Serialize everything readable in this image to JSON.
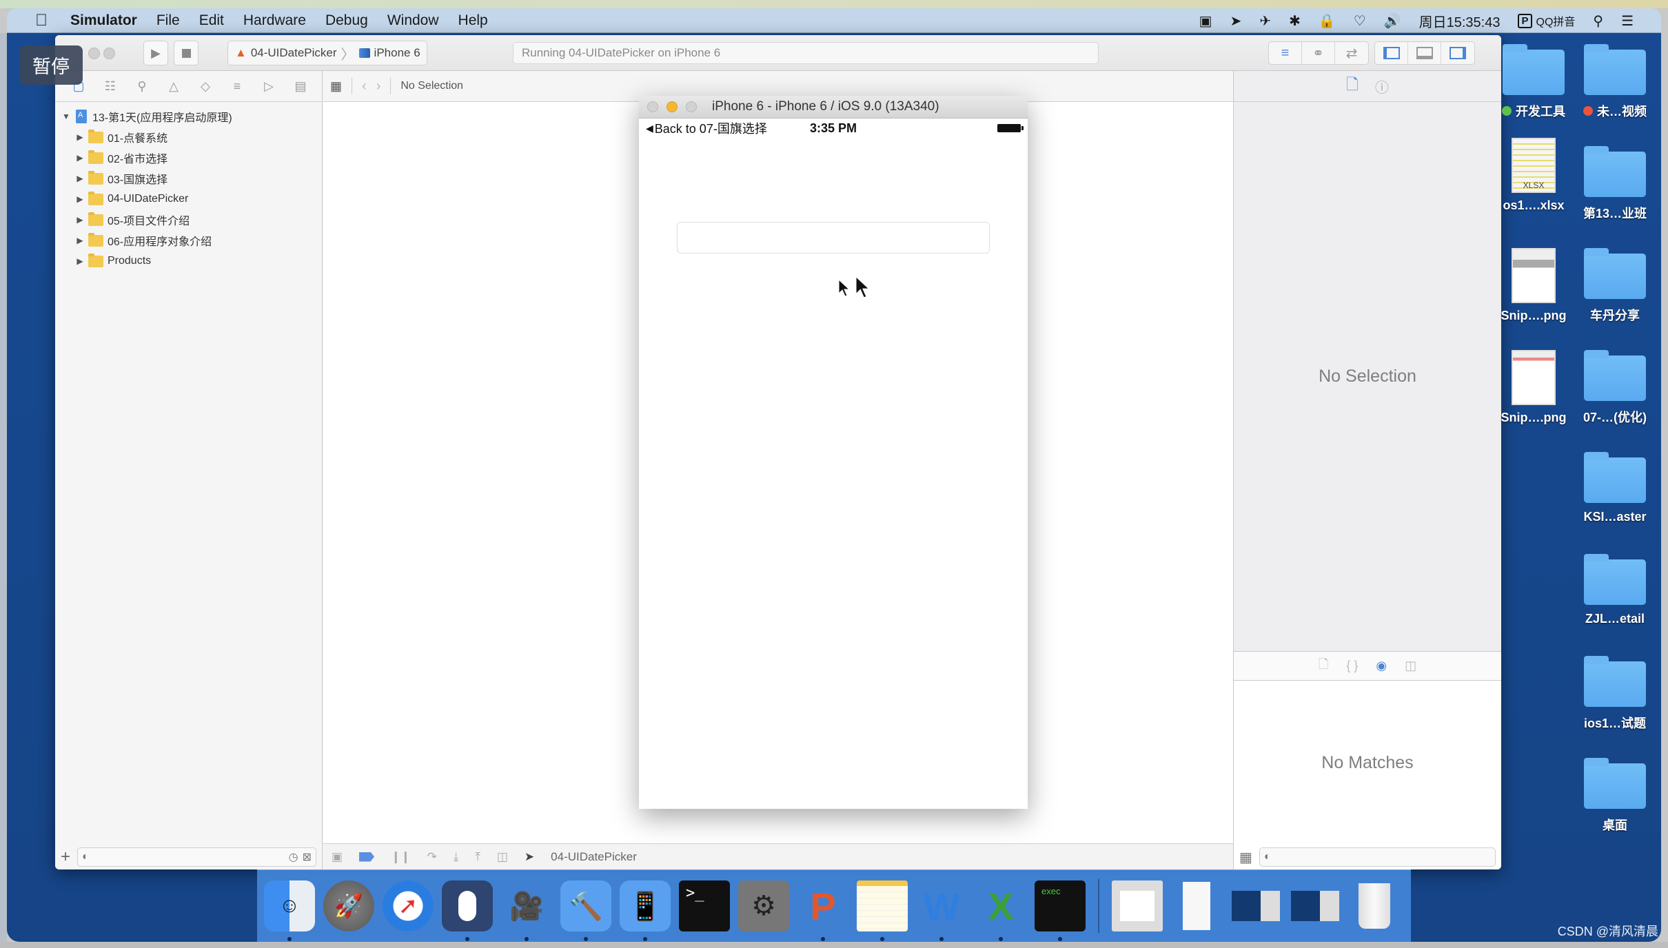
{
  "menubar": {
    "apple_icon": "apple-logo",
    "app_name": "Simulator",
    "items": [
      "File",
      "Edit",
      "Hardware",
      "Debug",
      "Window",
      "Help"
    ],
    "status_icons": [
      "screen-record-icon",
      "location-icon",
      "airplane-icon",
      "bluetooth-icon",
      "lock-icon",
      "wifi-icon",
      "volume-icon"
    ],
    "clock": "周日15:35:43",
    "ime_badge": "P",
    "ime_label": "QQ拼音",
    "spotlight_icon": "search-icon",
    "notification_icon": "list-icon"
  },
  "overlay": {
    "pause_label": "暂停"
  },
  "xcode": {
    "toolbar": {
      "run_icon": "play-icon",
      "stop_icon": "stop-icon",
      "scheme_name": "04-UIDatePicker",
      "scheme_separator": "〉",
      "device_name": "iPhone 6",
      "activity_text": "Running 04-UIDatePicker on iPhone 6",
      "editor_modes": [
        "standard-editor-icon",
        "assistant-editor-icon",
        "version-editor-icon"
      ],
      "view_toggles": [
        "navigator-toggle-icon",
        "debug-area-toggle-icon",
        "utilities-toggle-icon"
      ]
    },
    "navigator": {
      "tabs": [
        "project-icon",
        "symbol-icon",
        "find-icon",
        "issue-icon",
        "test-icon",
        "debug-icon",
        "breakpoint-icon",
        "report-icon"
      ],
      "root": {
        "label": "13-第1天(应用程序启动原理)",
        "expanded": true
      },
      "items": [
        {
          "label": "01-点餐系统"
        },
        {
          "label": "02-省市选择"
        },
        {
          "label": "03-国旗选择"
        },
        {
          "label": "04-UIDatePicker"
        },
        {
          "label": "05-项目文件介绍"
        },
        {
          "label": "06-应用程序对象介绍"
        },
        {
          "label": "Products"
        }
      ],
      "footer": {
        "add": "+",
        "filter_placeholder": ""
      }
    },
    "jump_bar": {
      "selection": "No Selection"
    },
    "debug_bar": {
      "target": "04-UIDatePicker"
    },
    "inspector": {
      "empty_text": "No Selection",
      "library_empty_text": "No Matches"
    }
  },
  "simulator": {
    "title": "iPhone 6 - iPhone 6 / iOS 9.0 (13A340)",
    "status": {
      "back_label": "Back to 07-国旗选择",
      "time": "3:35 PM"
    },
    "text_field_value": ""
  },
  "desktop": {
    "icons": [
      {
        "label": "开发工具",
        "type": "folder",
        "tag": "#5cc24a"
      },
      {
        "label": "未…视频",
        "type": "folder",
        "tag": "#e8553f"
      },
      {
        "label": "os1….xlsx",
        "type": "xlsx"
      },
      {
        "label": "第13…业班",
        "type": "folder"
      },
      {
        "label": "Snip….png",
        "type": "image"
      },
      {
        "label": "车丹分享",
        "type": "folder"
      },
      {
        "label": "Snip….png",
        "type": "image"
      },
      {
        "label": "07-…(优化)",
        "type": "folder"
      },
      {
        "label": "KSI…aster",
        "type": "folder"
      },
      {
        "label": "ZJL…etail",
        "type": "folder"
      },
      {
        "label": "ios1…试题",
        "type": "folder"
      },
      {
        "label": "桌面",
        "type": "folder"
      }
    ],
    "xlsx_badge": "XLSX"
  },
  "dock": {
    "apps": [
      {
        "name": "finder",
        "running": true
      },
      {
        "name": "launchpad",
        "running": false
      },
      {
        "name": "safari",
        "running": false
      },
      {
        "name": "mouse-app",
        "running": true
      },
      {
        "name": "screenflow",
        "running": true
      },
      {
        "name": "xcode",
        "running": true
      },
      {
        "name": "simulator",
        "running": true
      },
      {
        "name": "terminal",
        "running": false
      },
      {
        "name": "system-preferences",
        "running": false
      },
      {
        "name": "powerpoint",
        "running": true
      },
      {
        "name": "notes",
        "running": true
      },
      {
        "name": "word",
        "running": true
      },
      {
        "name": "excel",
        "running": true
      },
      {
        "name": "exec-console",
        "running": true
      }
    ],
    "docs": [
      "preview-document",
      "text-document",
      "screen-capture-1",
      "screen-capture-2",
      "trash"
    ],
    "terminal_glyph": ">_",
    "exec_label": "exec"
  },
  "watermark": "CSDN @清风清晨"
}
